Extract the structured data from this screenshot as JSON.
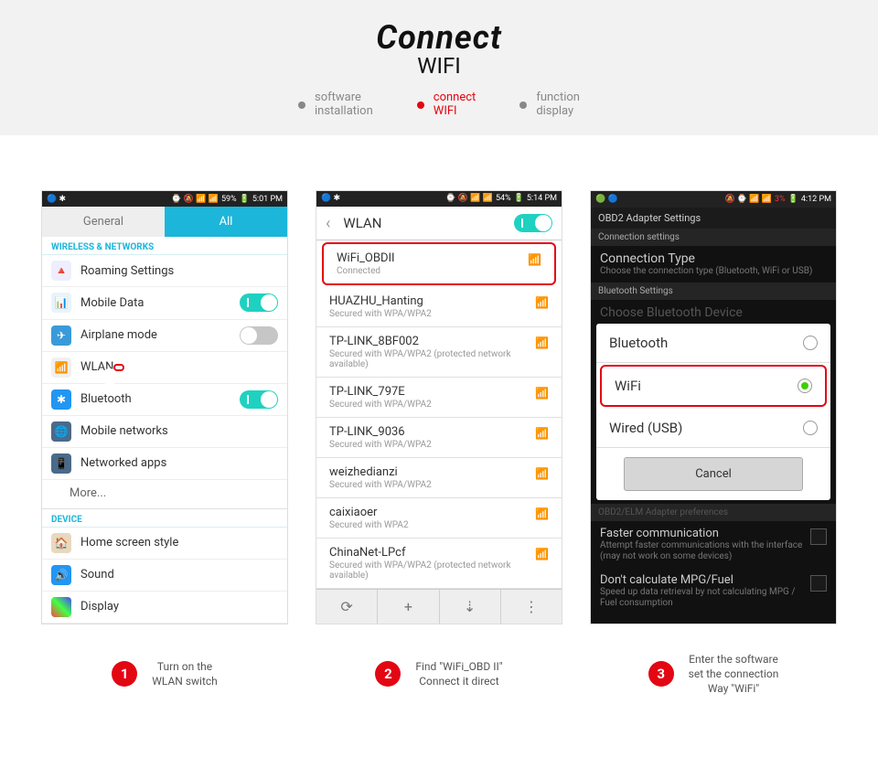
{
  "header": {
    "title_main": "Connect",
    "title_sub": "WIFI",
    "nav": [
      {
        "line1": "software",
        "line2": "installation",
        "active": false
      },
      {
        "line1": "connect",
        "line2": "WIFI",
        "active": true
      },
      {
        "line1": "function",
        "line2": "display",
        "active": false
      }
    ]
  },
  "phone1": {
    "status": {
      "battery": "59%",
      "time": "5:01 PM"
    },
    "tabs": {
      "general": "General",
      "all": "All"
    },
    "section_wireless": "WIRELESS & NETWORKS",
    "rows": {
      "roaming": "Roaming Settings",
      "mobile_data": "Mobile Data",
      "airplane": "Airplane mode",
      "wlan": "WLAN",
      "bluetooth": "Bluetooth",
      "mobile_networks": "Mobile networks",
      "networked_apps": "Networked apps",
      "more": "More..."
    },
    "section_device": "DEVICE",
    "device_rows": {
      "home": "Home screen style",
      "sound": "Sound",
      "display": "Display"
    }
  },
  "phone2": {
    "status": {
      "battery": "54%",
      "time": "5:14 PM"
    },
    "head": "WLAN",
    "nets": [
      {
        "name": "WiFi_OBDII",
        "sub": "Connected",
        "hi": true
      },
      {
        "name": "HUAZHU_Hanting",
        "sub": "Secured with WPA/WPA2"
      },
      {
        "name": "TP-LINK_8BF002",
        "sub": "Secured with WPA/WPA2 (protected network available)"
      },
      {
        "name": "TP-LINK_797E",
        "sub": "Secured with WPA/WPA2"
      },
      {
        "name": "TP-LINK_9036",
        "sub": "Secured with WPA/WPA2"
      },
      {
        "name": "weizhedianzi",
        "sub": "Secured with WPA/WPA2"
      },
      {
        "name": "caixiaoer",
        "sub": "Secured with WPA2"
      },
      {
        "name": "ChinaNet-LPcf",
        "sub": "Secured with WPA/WPA2 (protected network available)"
      }
    ]
  },
  "phone3": {
    "status": {
      "battery": "3%",
      "time": "4:12 PM"
    },
    "title": "OBD2 Adapter Settings",
    "sub1": "Connection settings",
    "conn_type": "Connection Type",
    "conn_desc": "Choose the connection type (Bluetooth, WiFi or USB)",
    "sub2": "Bluetooth Settings",
    "bt_device": "Choose Bluetooth Device",
    "dialog": {
      "bluetooth": "Bluetooth",
      "wifi": "WiFi",
      "wired": "Wired (USB)",
      "cancel": "Cancel"
    },
    "pref": "OBD2/ELM Adapter preferences",
    "faster": "Faster communication",
    "faster_desc": "Attempt faster communications with the interface (may not work on some devices)",
    "mpg": "Don't calculate MPG/Fuel",
    "mpg_desc": "Speed up data retrieval by not calculating MPG / Fuel consumption"
  },
  "captions": {
    "c1": "Turn on the\nWLAN switch",
    "c2": "Find  \"WiFi_OBD II\"\nConnect it direct",
    "c3": "Enter the software\nset the connection\nWay \"WiFi\""
  }
}
